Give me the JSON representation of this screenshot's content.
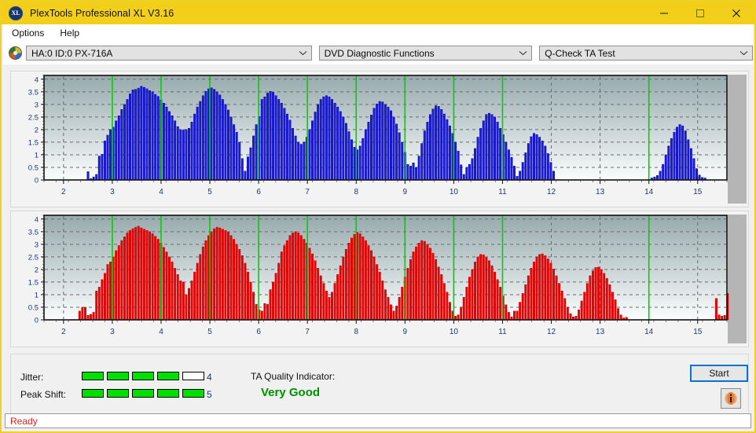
{
  "window": {
    "title": "PlexTools Professional XL V3.16",
    "app_icon": "xl-disc-icon",
    "minimize": "minimize-icon",
    "maximize": "maximize-icon",
    "close": "close-icon"
  },
  "menu": {
    "items": [
      {
        "label": "Options"
      },
      {
        "label": "Help"
      }
    ]
  },
  "toolbar": {
    "drive_icon": "disc-icon",
    "drive": {
      "value": "HA:0 ID:0  PX-716A"
    },
    "function": {
      "value": "DVD Diagnostic Functions"
    },
    "test": {
      "value": "Q-Check TA Test"
    },
    "dropdown_icon": "chevron-down-icon"
  },
  "results": {
    "jitter_label": "Jitter:",
    "jitter_value": "4",
    "jitter_filled": 4,
    "jitter_total": 5,
    "peak_shift_label": "Peak Shift:",
    "peak_shift_value": "5",
    "peak_shift_filled": 5,
    "peak_shift_total": 5,
    "quality_label": "TA Quality Indicator:",
    "quality_value": "Very Good",
    "quality_color": "#009000",
    "start_label": "Start",
    "info_icon": "info-icon"
  },
  "statusbar": {
    "text": "Ready",
    "color": "#e02020"
  },
  "colors": {
    "titlebar": "#f2cf1a",
    "blue_bar": "#1a1ae0",
    "red_bar": "#f00000",
    "marker_green": "#00d000",
    "plot_top": "#97aaad",
    "plot_bottom": "#fbfdfd"
  },
  "chart_data": [
    {
      "type": "bar",
      "name": "jitter-chart",
      "title": "",
      "xlabel": "",
      "ylabel": "",
      "series_color": "#1a1ae0",
      "xlim": [
        1.6,
        15.6
      ],
      "ylim": [
        0,
        4.15
      ],
      "yticks": [
        0,
        0.5,
        1,
        1.5,
        2,
        2.5,
        3,
        3.5,
        4
      ],
      "ytick_labels": [
        "0",
        "0.5",
        "1",
        "1.5",
        "2",
        "2.5",
        "3",
        "3.5",
        "4"
      ],
      "xticks": [
        2,
        3,
        4,
        5,
        6,
        7,
        8,
        9,
        10,
        11,
        12,
        13,
        14,
        15
      ],
      "xtick_labels": [
        "2",
        "3",
        "4",
        "5",
        "6",
        "7",
        "8",
        "9",
        "10",
        "11",
        "12",
        "13",
        "14",
        "15"
      ],
      "grid": true,
      "markers": [
        3,
        4,
        5,
        6,
        7,
        8,
        9,
        10,
        11,
        14
      ],
      "bar_step": 0.0575,
      "x_start": 1.62,
      "values": [
        0,
        0,
        0,
        0,
        0,
        0,
        0,
        0,
        0,
        0,
        0,
        0,
        0,
        0,
        0,
        0.33,
        0.05,
        0.12,
        0.22,
        0.95,
        1.02,
        1.55,
        1.78,
        2.0,
        2.1,
        2.35,
        2.55,
        2.8,
        3.0,
        3.2,
        3.42,
        3.58,
        3.6,
        3.65,
        3.72,
        3.68,
        3.62,
        3.55,
        3.5,
        3.4,
        3.32,
        3.18,
        3.05,
        2.9,
        2.72,
        2.55,
        2.35,
        2.12,
        2.0,
        1.98,
        2.0,
        2.05,
        2.3,
        2.62,
        2.9,
        3.12,
        3.35,
        3.52,
        3.62,
        3.66,
        3.6,
        3.5,
        3.38,
        3.2,
        3.0,
        2.78,
        2.5,
        2.2,
        1.9,
        1.5,
        0.85,
        0.35,
        0.92,
        1.28,
        1.75,
        2.2,
        2.52,
        3.2,
        3.3,
        3.45,
        3.52,
        3.48,
        3.35,
        3.2,
        3.05,
        2.85,
        2.62,
        2.38,
        2.05,
        1.75,
        1.5,
        1.42,
        1.5,
        1.7,
        2.0,
        2.35,
        2.7,
        3.0,
        3.2,
        3.3,
        3.35,
        3.3,
        3.2,
        3.05,
        2.9,
        2.72,
        2.5,
        2.25,
        1.92,
        1.6,
        1.3,
        1.2,
        1.35,
        1.65,
        2.0,
        2.3,
        2.58,
        2.85,
        3.02,
        3.12,
        3.1,
        3.0,
        2.9,
        2.75,
        2.5,
        2.22,
        1.88,
        1.5,
        1.1,
        0.62,
        0.55,
        0.68,
        0.5,
        0.95,
        1.45,
        1.95,
        2.3,
        2.6,
        2.82,
        2.95,
        2.92,
        2.8,
        2.62,
        2.4,
        2.15,
        1.85,
        1.5,
        1.15,
        0.6,
        0.22,
        0.5,
        0.62,
        0.85,
        1.25,
        1.7,
        2.05,
        2.35,
        2.6,
        2.65,
        2.6,
        2.5,
        2.3,
        2.05,
        1.8,
        1.5,
        1.2,
        0.9,
        0.55,
        0.15,
        0.35,
        0.7,
        1.08,
        1.45,
        1.72,
        1.85,
        1.8,
        1.7,
        1.55,
        1.35,
        1.05,
        0.7,
        0.35,
        0,
        0,
        0,
        0,
        0,
        0,
        0,
        0,
        0,
        0,
        0,
        0,
        0,
        0,
        0,
        0,
        0,
        0,
        0,
        0,
        0,
        0,
        0,
        0,
        0,
        0,
        0,
        0,
        0,
        0,
        0,
        0,
        0,
        0,
        0.08,
        0.12,
        0.18,
        0.35,
        0.62,
        1.0,
        1.35,
        1.65,
        1.9,
        2.1,
        2.2,
        2.15,
        1.95,
        1.6,
        1.25,
        0.85,
        0.45,
        0.2,
        0.1,
        0.08,
        0,
        0,
        0,
        0,
        0,
        0,
        0,
        0,
        0,
        0,
        0,
        0,
        0,
        0,
        0,
        0,
        0,
        0,
        0,
        0,
        0,
        0,
        0,
        0,
        0,
        0,
        0,
        0
      ]
    },
    {
      "type": "bar",
      "name": "peak-shift-chart",
      "title": "",
      "xlabel": "",
      "ylabel": "",
      "series_color": "#f00000",
      "xlim": [
        1.6,
        15.6
      ],
      "ylim": [
        0,
        4.15
      ],
      "yticks": [
        0,
        0.5,
        1,
        1.5,
        2,
        2.5,
        3,
        3.5,
        4
      ],
      "ytick_labels": [
        "0",
        "0.5",
        "1",
        "1.5",
        "2",
        "2.5",
        "3",
        "3.5",
        "4"
      ],
      "xticks": [
        2,
        3,
        4,
        5,
        6,
        7,
        8,
        9,
        10,
        11,
        12,
        13,
        14,
        15
      ],
      "xtick_labels": [
        "2",
        "3",
        "4",
        "5",
        "6",
        "7",
        "8",
        "9",
        "10",
        "11",
        "12",
        "13",
        "14",
        "15"
      ],
      "grid": true,
      "markers": [
        3,
        4,
        5,
        6,
        7,
        8,
        9,
        10,
        11,
        14
      ],
      "bar_step": 0.0575,
      "x_start": 1.62,
      "values": [
        0,
        0,
        0,
        0,
        0,
        0,
        0,
        0,
        0,
        0,
        0,
        0,
        0.35,
        0.5,
        0.5,
        0.18,
        0.22,
        0.3,
        1.15,
        1.3,
        1.6,
        1.85,
        2.2,
        2.3,
        2.5,
        2.75,
        2.95,
        3.15,
        3.3,
        3.45,
        3.55,
        3.62,
        3.68,
        3.72,
        3.65,
        3.6,
        3.55,
        3.5,
        3.42,
        3.32,
        3.2,
        3.05,
        2.88,
        2.7,
        2.5,
        2.3,
        2.05,
        1.8,
        1.55,
        1.5,
        1.0,
        1.25,
        1.55,
        1.9,
        2.25,
        2.6,
        2.9,
        3.15,
        3.35,
        3.5,
        3.62,
        3.68,
        3.65,
        3.6,
        3.55,
        3.48,
        3.35,
        3.2,
        3.0,
        2.8,
        2.55,
        2.25,
        1.9,
        1.5,
        1.1,
        0.62,
        0.4,
        0.35,
        0.65,
        0.62,
        1.2,
        1.5,
        1.85,
        2.25,
        2.7,
        2.95,
        3.15,
        3.35,
        3.45,
        3.5,
        3.45,
        3.35,
        3.2,
        3.05,
        2.85,
        2.62,
        2.35,
        2.05,
        1.75,
        1.45,
        1.15,
        0.9,
        1.1,
        1.45,
        1.8,
        2.15,
        2.5,
        2.8,
        3.05,
        3.25,
        3.4,
        3.48,
        3.42,
        3.3,
        3.15,
        2.95,
        2.75,
        2.5,
        2.2,
        1.9,
        1.55,
        1.2,
        0.9,
        0.6,
        0.35,
        0.55,
        0.9,
        1.3,
        1.7,
        2.05,
        2.4,
        2.7,
        2.9,
        3.05,
        3.15,
        3.12,
        3.0,
        2.85,
        2.65,
        2.4,
        2.1,
        1.8,
        1.45,
        1.1,
        0.7,
        0.35,
        0.15,
        0.2,
        0.5,
        0.9,
        1.3,
        1.7,
        2.0,
        2.3,
        2.5,
        2.6,
        2.58,
        2.48,
        2.35,
        2.15,
        1.9,
        1.6,
        1.3,
        0.95,
        0.6,
        0.3,
        0.12,
        0.35,
        0.35,
        0.7,
        1.05,
        1.4,
        1.75,
        2.05,
        2.3,
        2.5,
        2.6,
        2.62,
        2.55,
        2.42,
        2.25,
        2.02,
        1.75,
        1.45,
        1.15,
        0.85,
        0.5,
        0.25,
        0.12,
        0.15,
        0.4,
        0.75,
        1.1,
        1.45,
        1.75,
        1.95,
        2.08,
        2.1,
        2.0,
        1.85,
        1.65,
        1.4,
        1.1,
        0.8,
        0.45,
        0.2,
        0.08,
        0.1,
        0,
        0,
        0,
        0,
        0,
        0,
        0,
        0,
        0,
        0,
        0,
        0,
        0,
        0,
        0,
        0,
        0,
        0,
        0,
        0,
        0,
        0,
        0,
        0,
        0,
        0,
        0,
        0,
        0,
        0,
        0,
        0.85,
        0.2,
        0.15,
        0.18,
        1.05,
        0.15,
        1.2,
        0.95,
        1.05,
        0.2,
        0.85,
        0.05,
        0,
        0.22,
        0.05,
        0,
        0,
        0,
        0,
        0,
        0,
        0,
        0,
        0,
        0,
        0,
        0,
        0,
        0,
        0,
        0,
        0,
        0,
        0,
        0,
        0,
        0,
        0,
        0,
        0,
        0,
        0,
        0,
        0,
        0
      ]
    }
  ]
}
